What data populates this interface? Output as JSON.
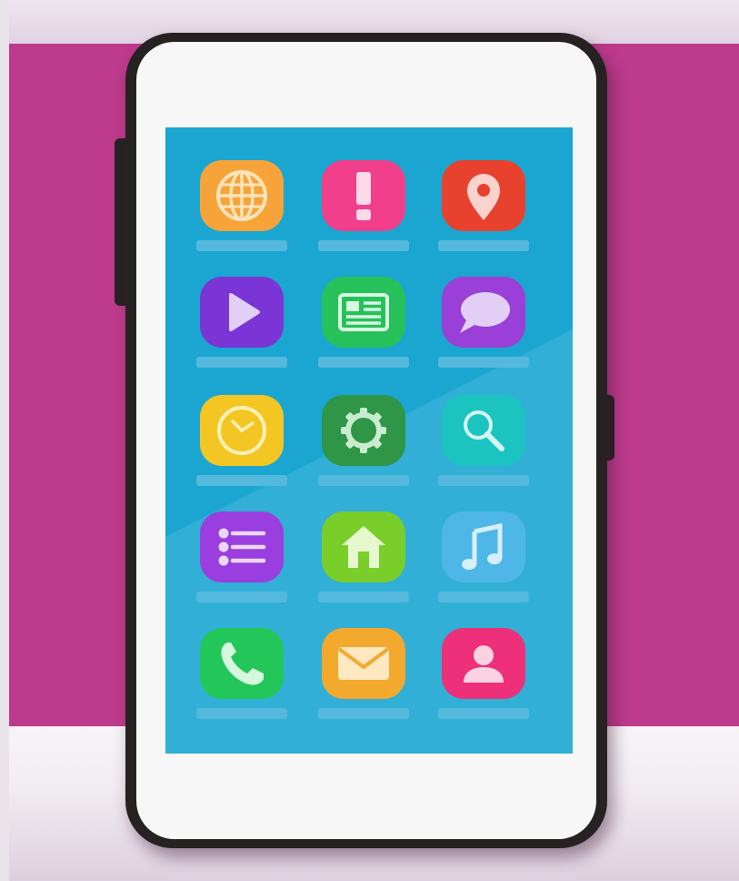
{
  "colors": {
    "wall_band": "#bd3a8c",
    "phone_body": "#262222",
    "phone_face": "#f7f7f7",
    "screen": "#1aa6d1",
    "label_placeholder": "#54b9dd"
  },
  "home_screen": {
    "apps": [
      {
        "name": "browser",
        "icon": "globe-icon",
        "color": "#f6a43a"
      },
      {
        "name": "alerts",
        "icon": "exclamation-icon",
        "color": "#f13f8c"
      },
      {
        "name": "maps",
        "icon": "map-pin-icon",
        "color": "#e8422f"
      },
      {
        "name": "video",
        "icon": "play-icon",
        "color": "#7b35d6"
      },
      {
        "name": "news",
        "icon": "newspaper-icon",
        "color": "#26c15b"
      },
      {
        "name": "messages",
        "icon": "chat-bubble-icon",
        "color": "#9a40d8"
      },
      {
        "name": "clock",
        "icon": "clock-icon",
        "color": "#f4c623"
      },
      {
        "name": "settings",
        "icon": "gear-icon",
        "color": "#2e9646"
      },
      {
        "name": "search",
        "icon": "magnifier-icon",
        "color": "#1bc4c0"
      },
      {
        "name": "notes",
        "icon": "list-icon",
        "color": "#9b3ee0"
      },
      {
        "name": "home",
        "icon": "house-icon",
        "color": "#7ace2a"
      },
      {
        "name": "music",
        "icon": "music-note-icon",
        "color": "#4fb7e8"
      },
      {
        "name": "phone",
        "icon": "phone-handset-icon",
        "color": "#23c659"
      },
      {
        "name": "mail",
        "icon": "envelope-icon",
        "color": "#f3a92e"
      },
      {
        "name": "contacts",
        "icon": "person-icon",
        "color": "#ee2f7a"
      }
    ]
  }
}
